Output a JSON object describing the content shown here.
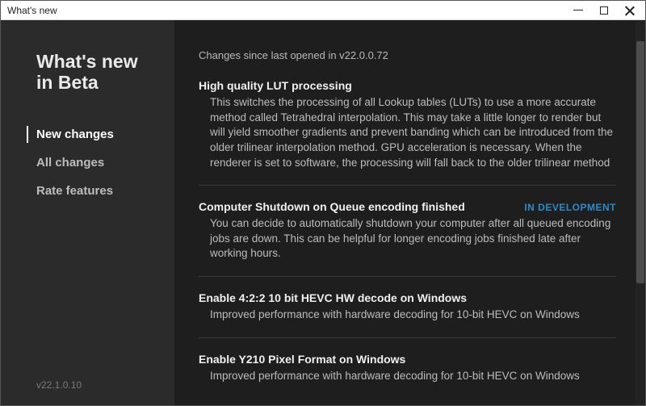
{
  "window": {
    "title": "What's new"
  },
  "sidebar": {
    "heading": "What's new\nin Beta",
    "nav": [
      {
        "label": "New changes",
        "active": true
      },
      {
        "label": "All changes",
        "active": false
      },
      {
        "label": "Rate features",
        "active": false
      }
    ],
    "version": "v22.1.0.10"
  },
  "content": {
    "changes_since": "Changes since last opened in v22.0.0.72",
    "features": [
      {
        "title": "High quality LUT processing",
        "badge": "",
        "description": "This switches the processing of all Lookup tables (LUTs) to use a more accurate method called Tetrahedral interpolation. This may take a little longer to render but will yield smoother gradients and prevent banding which can be introduced from the older trilinear interpolation method. GPU acceleration is necessary. When the renderer is set to software, the processing will fall back to the older trilinear method"
      },
      {
        "title": "Computer Shutdown on Queue encoding finished",
        "badge": "IN DEVELOPMENT",
        "description": "You can decide to automatically shutdown your computer after all queued encoding jobs are down. This can be helpful for longer encoding jobs finished late after working hours."
      },
      {
        "title": "Enable 4:2:2 10 bit HEVC HW decode on Windows",
        "badge": "",
        "description": "Improved performance with hardware decoding for 10-bit HEVC on Windows"
      },
      {
        "title": "Enable Y210 Pixel Format on Windows",
        "badge": "",
        "description": "Improved performance with hardware decoding for 10-bit HEVC on Windows"
      }
    ]
  }
}
